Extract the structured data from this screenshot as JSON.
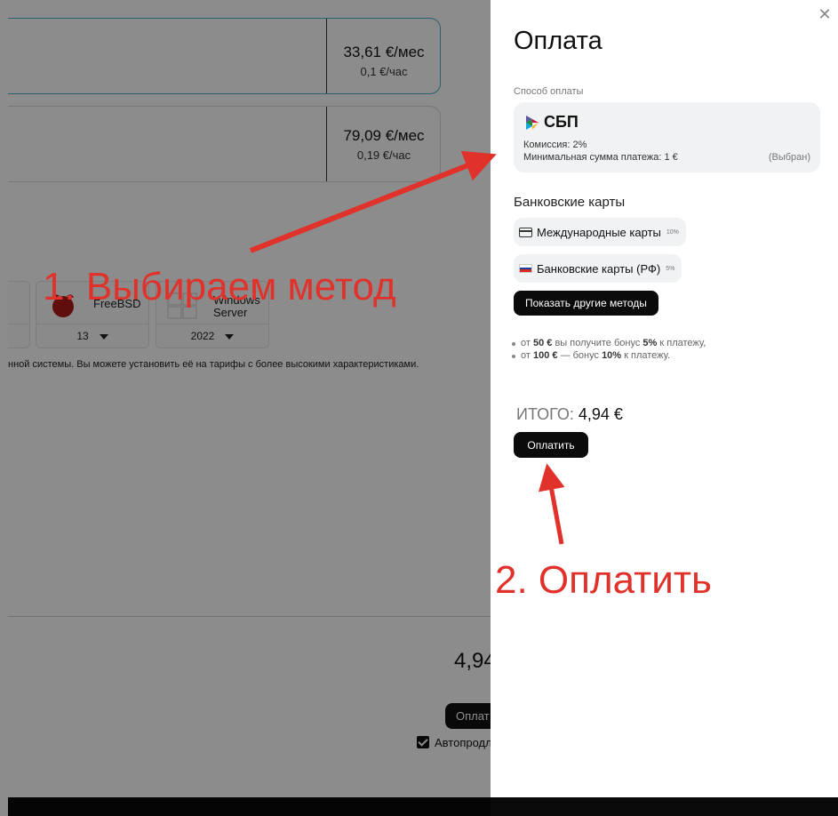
{
  "background": {
    "plans": [
      {
        "price": "33,61 €/мес",
        "hourly": "0,1 €/час"
      },
      {
        "price": "79,09 €/мес",
        "hourly": "0,19 €/час"
      }
    ],
    "os_tiles": [
      {
        "name": "FreeBSD",
        "version": "13"
      },
      {
        "name": "Windows Server",
        "version": "2022"
      }
    ],
    "os_note": "нной системы. Вы можете установить её на тарифы с более высокими характеристиками.",
    "total": "4,94",
    "pay_label": "Оплат",
    "autorenew_label": "Автопродл"
  },
  "panel": {
    "title": "Оплата",
    "method_label": "Способ оплаты",
    "selected_method": {
      "name": "СБП",
      "fee": "Комиссия: 2%",
      "min_sum": "Минимальная сумма платежа: 1 €",
      "status": "(Выбран)"
    },
    "bank_cards_title": "Банковские карты",
    "bank_options": [
      {
        "label": "Международные карты",
        "percent": "10%",
        "icon": "credit-card-icon"
      },
      {
        "label": "Банковские карты (РФ)",
        "percent": "5%",
        "icon": "russia-flag-icon"
      }
    ],
    "more_methods_label": "Показать другие методы",
    "bonus": [
      {
        "pre": "от ",
        "amount": "50 €",
        "mid": " вы получите бонус ",
        "pct": "5%",
        "post": " к платежу,"
      },
      {
        "pre": "от ",
        "amount": "100 €",
        "mid": " — бонус ",
        "pct": "10%",
        "post": " к платежу."
      }
    ],
    "total_label": "ИТОГО:",
    "total_value": "4,94 €",
    "pay_label": "Оплатить"
  },
  "annotations": {
    "step1": "1. Выбираем метод",
    "step2": "2. Оплатить"
  },
  "colors": {
    "annotation": "#e0322a",
    "overlay": "rgba(0,0,0,0.45)",
    "button": "#0b0b0b"
  }
}
